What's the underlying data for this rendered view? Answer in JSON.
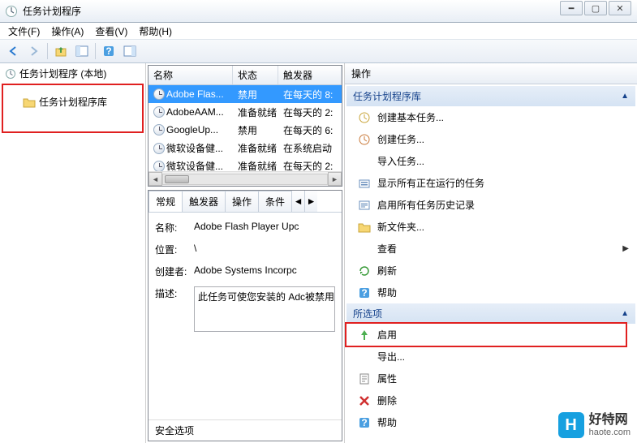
{
  "titlebar": {
    "title": "任务计划程序"
  },
  "menu": {
    "file": "文件(F)",
    "action": "操作(A)",
    "view": "查看(V)",
    "help": "帮助(H)"
  },
  "tree": {
    "root": "任务计划程序 (本地)",
    "library": "任务计划程序库"
  },
  "tasks": {
    "columns": {
      "name": "名称",
      "state": "状态",
      "trigger": "触发器"
    },
    "rows": [
      {
        "name": "Adobe Flas...",
        "state": "禁用",
        "trigger": "在每天的 8:"
      },
      {
        "name": "AdobeAAM...",
        "state": "准备就绪",
        "trigger": "在每天的 2:"
      },
      {
        "name": "GoogleUp...",
        "state": "禁用",
        "trigger": "在每天的 6:"
      },
      {
        "name": "微软设备健...",
        "state": "准备就绪",
        "trigger": "在系统启动"
      },
      {
        "name": "微软设备健...",
        "state": "准备就绪",
        "trigger": "在每天的 2:"
      }
    ]
  },
  "detail": {
    "tabs": {
      "general": "常规",
      "triggers": "触发器",
      "actions": "操作",
      "conditions": "条件"
    },
    "fields": {
      "name_label": "名称:",
      "name_value": "Adobe Flash Player Upc",
      "location_label": "位置:",
      "location_value": "\\",
      "author_label": "创建者:",
      "author_value": "Adobe Systems Incorpc",
      "desc_label": "描述:",
      "desc_value": "此任务可使您安装的 Adc被禁用或删除，则 Adobe"
    },
    "footer": "安全选项"
  },
  "actions": {
    "header": "操作",
    "section1": {
      "title": "任务计划程序库"
    },
    "items1": {
      "create_basic": "创建基本任务...",
      "create": "创建任务...",
      "import": "导入任务...",
      "show_running": "显示所有正在运行的任务",
      "enable_history": "启用所有任务历史记录",
      "new_folder": "新文件夹...",
      "view": "查看",
      "refresh": "刷新",
      "help": "帮助"
    },
    "section2": {
      "title": "所选项"
    },
    "items2": {
      "enable": "启用",
      "export": "导出...",
      "properties": "属性",
      "delete": "删除",
      "help2": "帮助"
    }
  },
  "watermark": {
    "brand": "好特网",
    "url": "haote.com",
    "logo": "H"
  }
}
